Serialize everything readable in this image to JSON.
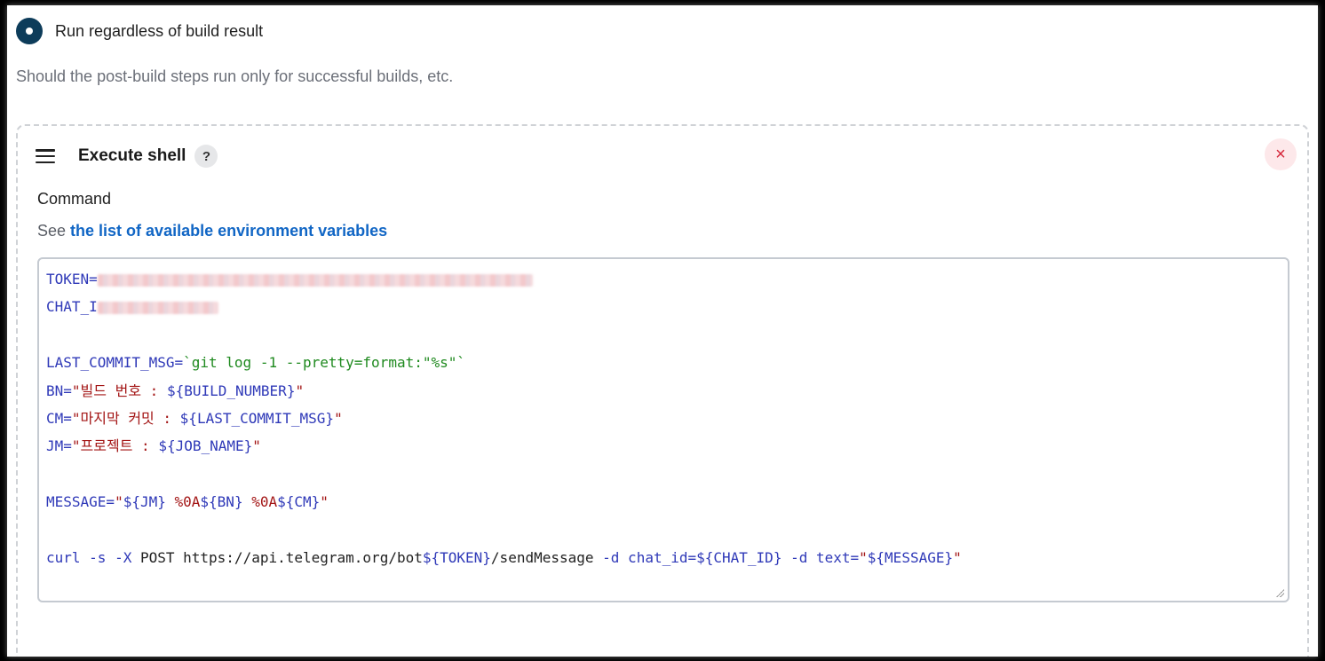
{
  "radio": {
    "label": "Run regardless of build result",
    "selected": true
  },
  "description": "Should the post-build steps run only for successful builds, etc.",
  "step": {
    "title": "Execute shell",
    "help_label": "?",
    "close_icon": "×",
    "command_label": "Command",
    "env_prefix": "See",
    "env_link": "the list of available environment variables",
    "code_lines": [
      {
        "parts": [
          {
            "cls": "k",
            "text": "TOKEN="
          },
          {
            "cls": "blur",
            "text": "[redacted]"
          }
        ]
      },
      {
        "parts": [
          {
            "cls": "k",
            "text": "CHAT_I"
          },
          {
            "cls": "blur",
            "text": "[redacted]"
          }
        ]
      },
      {
        "parts": []
      },
      {
        "parts": [
          {
            "cls": "k",
            "text": "LAST_COMMIT_MSG="
          },
          {
            "cls": "g",
            "text": "`git log -1 --pretty=format:\"%s\"`"
          }
        ]
      },
      {
        "parts": [
          {
            "cls": "k",
            "text": "BN="
          },
          {
            "cls": "s",
            "text": "\"빌드 번호 : "
          },
          {
            "cls": "k",
            "text": "${BUILD_NUMBER}"
          },
          {
            "cls": "s",
            "text": "\""
          }
        ]
      },
      {
        "parts": [
          {
            "cls": "k",
            "text": "CM="
          },
          {
            "cls": "s",
            "text": "\"마지막 커밋 : "
          },
          {
            "cls": "k",
            "text": "${LAST_COMMIT_MSG}"
          },
          {
            "cls": "s",
            "text": "\""
          }
        ]
      },
      {
        "parts": [
          {
            "cls": "k",
            "text": "JM="
          },
          {
            "cls": "s",
            "text": "\"프로젝트 : "
          },
          {
            "cls": "k",
            "text": "${JOB_NAME}"
          },
          {
            "cls": "s",
            "text": "\""
          }
        ]
      },
      {
        "parts": []
      },
      {
        "parts": [
          {
            "cls": "k",
            "text": "MESSAGE="
          },
          {
            "cls": "s",
            "text": "\""
          },
          {
            "cls": "k",
            "text": "${JM}"
          },
          {
            "cls": "s",
            "text": " %0A"
          },
          {
            "cls": "k",
            "text": "${BN}"
          },
          {
            "cls": "s",
            "text": " %0A"
          },
          {
            "cls": "k",
            "text": "${CM}"
          },
          {
            "cls": "s",
            "text": "\""
          }
        ]
      },
      {
        "parts": []
      },
      {
        "parts": [
          {
            "cls": "k",
            "text": "curl -s -X "
          },
          {
            "cls": "t",
            "text": "POST https://api.telegram.org/bot"
          },
          {
            "cls": "k",
            "text": "${TOKEN}"
          },
          {
            "cls": "t",
            "text": "/sendMessage "
          },
          {
            "cls": "k",
            "text": "-d chat_id=${CHAT_ID} -d text="
          },
          {
            "cls": "s",
            "text": "\""
          },
          {
            "cls": "k",
            "text": "${MESSAGE}"
          },
          {
            "cls": "s",
            "text": "\""
          }
        ]
      }
    ]
  },
  "colors": {
    "radio_fill": "#0d3c5a",
    "link": "#1166c5",
    "close_bg": "#fde8ea",
    "close_fg": "#d6273b",
    "code_keyword": "#2f39b8",
    "code_string": "#a31515",
    "code_command": "#1f8a1f"
  }
}
